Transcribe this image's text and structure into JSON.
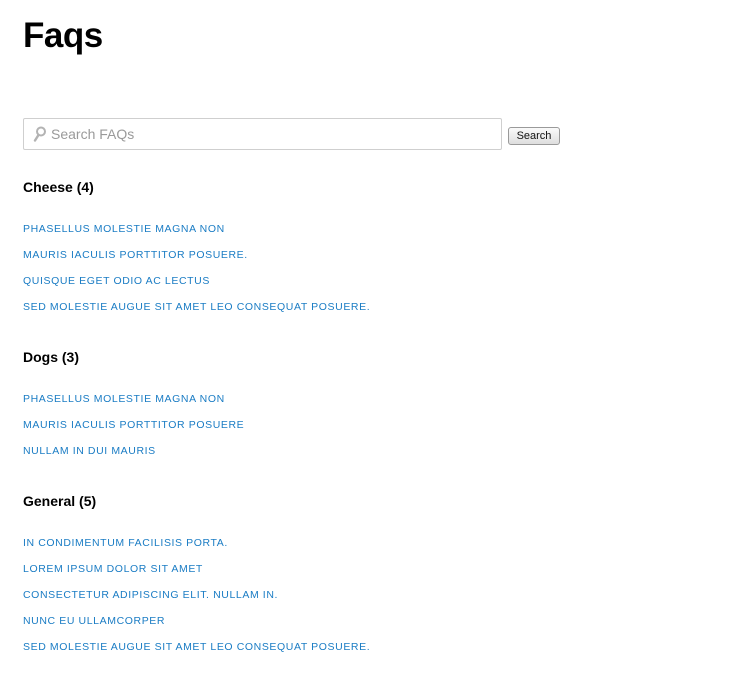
{
  "page": {
    "title": "Faqs"
  },
  "search": {
    "placeholder": "Search FAQs",
    "button_label": "Search"
  },
  "categories": [
    {
      "name": "Cheese",
      "count": "(4)",
      "items": [
        "PHASELLUS MOLESTIE MAGNA NON",
        "MAURIS IACULIS PORTTITOR POSUERE.",
        "QUISQUE EGET ODIO AC LECTUS",
        "SED MOLESTIE AUGUE SIT AMET LEO CONSEQUAT POSUERE."
      ]
    },
    {
      "name": "Dogs",
      "count": "(3)",
      "items": [
        "PHASELLUS MOLESTIE MAGNA NON",
        "MAURIS IACULIS PORTTITOR POSUERE",
        "NULLAM IN DUI MAURIS"
      ]
    },
    {
      "name": "General",
      "count": "(5)",
      "items": [
        "IN CONDIMENTUM FACILISIS PORTA.",
        "LOREM IPSUM DOLOR SIT AMET",
        "CONSECTETUR ADIPISCING ELIT. NULLAM IN.",
        "NUNC EU ULLAMCORPER",
        "SED MOLESTIE AUGUE SIT AMET LEO CONSEQUAT POSUERE."
      ]
    }
  ],
  "colors": {
    "link": "#1a7cc4",
    "heading": "#000000",
    "placeholder": "#9a9a9a"
  },
  "icons": {
    "search": "search-icon"
  }
}
